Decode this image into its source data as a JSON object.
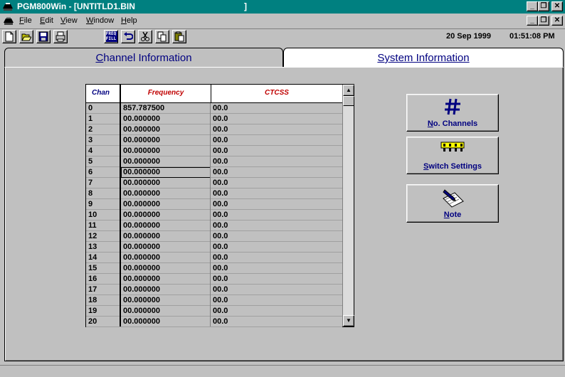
{
  "window": {
    "title": "PGM800Win - [UNTITLD1.BIN",
    "title_tail": "]"
  },
  "menu": {
    "items": [
      {
        "label": "File",
        "hotkey": "F",
        "rest": "ile"
      },
      {
        "label": "Edit",
        "hotkey": "E",
        "rest": "dit"
      },
      {
        "label": "View",
        "hotkey": "V",
        "rest": "iew"
      },
      {
        "label": "Window",
        "hotkey": "W",
        "rest": "indow"
      },
      {
        "label": "Help",
        "hotkey": "H",
        "rest": "elp"
      }
    ]
  },
  "toolbar": {
    "freq_fill_line1": "FREQ",
    "freq_fill_line2": "FILL",
    "date": "20 Sep 1999",
    "time": "01:51:08 PM"
  },
  "tabs": {
    "channel": {
      "hotkey": "C",
      "rest": "hannel Information"
    },
    "system": {
      "label": "System Information"
    }
  },
  "grid": {
    "headers": {
      "chan": "Chan",
      "frequency": "Frequency",
      "ctcss": "CTCSS"
    },
    "rows": [
      {
        "chan": "0",
        "frequency": "857.787500",
        "ctcss": "00.0"
      },
      {
        "chan": "1",
        "frequency": "00.000000",
        "ctcss": "00.0"
      },
      {
        "chan": "2",
        "frequency": "00.000000",
        "ctcss": "00.0"
      },
      {
        "chan": "3",
        "frequency": "00.000000",
        "ctcss": "00.0"
      },
      {
        "chan": "4",
        "frequency": "00.000000",
        "ctcss": "00.0"
      },
      {
        "chan": "5",
        "frequency": "00.000000",
        "ctcss": "00.0"
      },
      {
        "chan": "6",
        "frequency": "00.000000",
        "ctcss": "00.0"
      },
      {
        "chan": "7",
        "frequency": "00.000000",
        "ctcss": "00.0"
      },
      {
        "chan": "8",
        "frequency": "00.000000",
        "ctcss": "00.0"
      },
      {
        "chan": "9",
        "frequency": "00.000000",
        "ctcss": "00.0"
      },
      {
        "chan": "10",
        "frequency": "00.000000",
        "ctcss": "00.0"
      },
      {
        "chan": "11",
        "frequency": "00.000000",
        "ctcss": "00.0"
      },
      {
        "chan": "12",
        "frequency": "00.000000",
        "ctcss": "00.0"
      },
      {
        "chan": "13",
        "frequency": "00.000000",
        "ctcss": "00.0"
      },
      {
        "chan": "14",
        "frequency": "00.000000",
        "ctcss": "00.0"
      },
      {
        "chan": "15",
        "frequency": "00.000000",
        "ctcss": "00.0"
      },
      {
        "chan": "16",
        "frequency": "00.000000",
        "ctcss": "00.0"
      },
      {
        "chan": "17",
        "frequency": "00.000000",
        "ctcss": "00.0"
      },
      {
        "chan": "18",
        "frequency": "00.000000",
        "ctcss": "00.0"
      },
      {
        "chan": "19",
        "frequency": "00.000000",
        "ctcss": "00.0"
      },
      {
        "chan": "20",
        "frequency": "00.000000",
        "ctcss": "00.0"
      }
    ],
    "focused_row": 6
  },
  "buttons": {
    "channels": {
      "hotkey": "N",
      "rest": "o. Channels"
    },
    "switch": {
      "hotkey": "S",
      "rest": "witch Settings"
    },
    "note": {
      "hotkey": "N",
      "rest": "ote"
    }
  },
  "colors": {
    "titlebar": "#008080",
    "accent_text": "#000080",
    "header_red": "#c00000"
  },
  "icons": [
    "app-icon",
    "new-icon",
    "open-icon",
    "save-icon",
    "print-icon",
    "freq-fill-icon",
    "undo-icon",
    "cut-icon",
    "copy-icon",
    "paste-icon",
    "hash-icon",
    "dip-switch-icon",
    "note-pad-icon"
  ]
}
